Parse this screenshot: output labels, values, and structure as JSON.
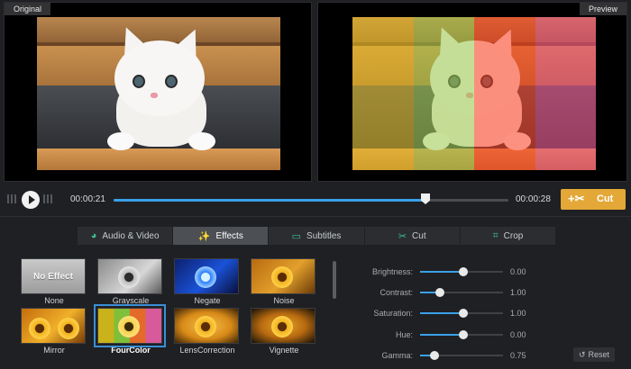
{
  "preview": {
    "original_label": "Original",
    "preview_label": "Preview",
    "fourcolor_tints": [
      "#e8c020",
      "#9ccb4a",
      "#ff3a1e",
      "#f04b86"
    ]
  },
  "timeline": {
    "current_time": "00:00:21",
    "end_time": "00:00:28",
    "progress": 0.79,
    "cut_label": "Cut"
  },
  "tabs": [
    {
      "label": "Audio & Video",
      "icon": "audio-video-icon",
      "glyph": "◕"
    },
    {
      "label": "Effects",
      "icon": "magic-wand-icon",
      "glyph": "✨"
    },
    {
      "label": "Subtitles",
      "icon": "subtitles-icon",
      "glyph": "▭"
    },
    {
      "label": "Cut",
      "icon": "scissors-icon",
      "glyph": "✂"
    },
    {
      "label": "Crop",
      "icon": "crop-icon",
      "glyph": "⌗"
    }
  ],
  "active_tab": "Effects",
  "effects": [
    {
      "label": "None",
      "badge": "No Effect"
    },
    {
      "label": "Grayscale"
    },
    {
      "label": "Negate"
    },
    {
      "label": "Noise"
    },
    {
      "label": "Mirror"
    },
    {
      "label": "FourColor"
    },
    {
      "label": "LensCorrection"
    },
    {
      "label": "Vignette"
    }
  ],
  "selected_effect": "FourColor",
  "adjustments": [
    {
      "label": "Brightness:",
      "value": "0.00",
      "level": 0.52
    },
    {
      "label": "Contrast:",
      "value": "1.00",
      "level": 0.24
    },
    {
      "label": "Saturation:",
      "value": "1.00",
      "level": 0.52
    },
    {
      "label": "Hue:",
      "value": "0.00",
      "level": 0.52
    },
    {
      "label": "Gamma:",
      "value": "0.75",
      "level": 0.17
    }
  ],
  "reset_label": "Reset",
  "colors": {
    "accent": "#3aa0e8",
    "cut_button": "#e3a838",
    "selection_border": "#3a8fd6"
  }
}
